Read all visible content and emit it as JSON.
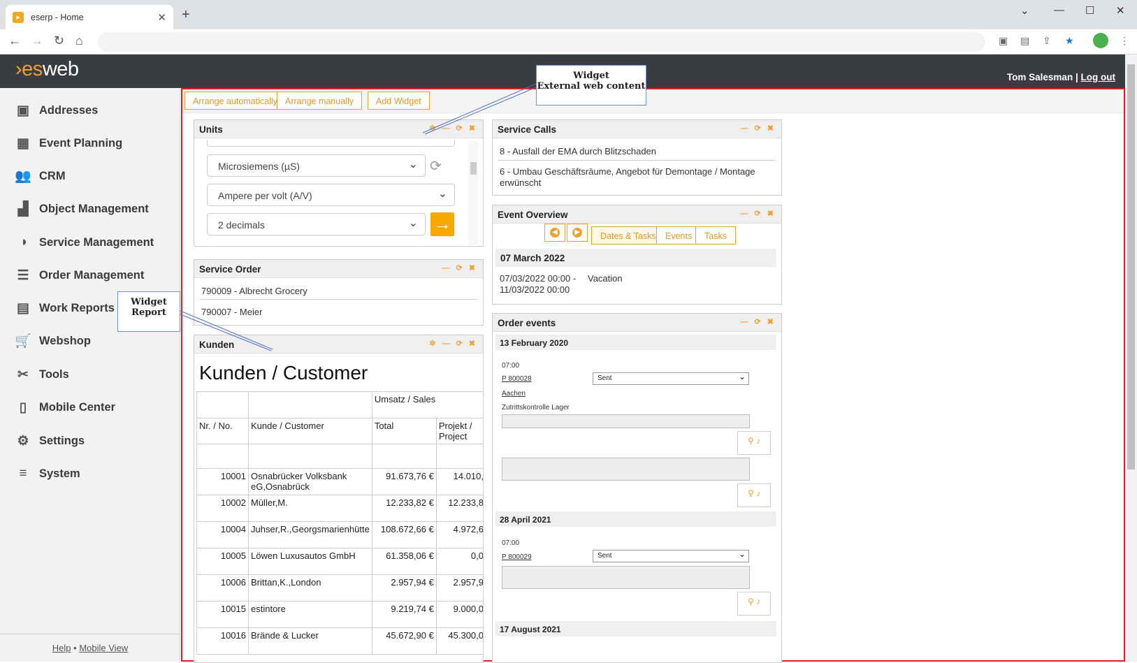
{
  "browser": {
    "tab_title": "eserp - Home",
    "new_tab": "+",
    "close": "✕"
  },
  "app": {
    "logo_accent": "›",
    "logo_es": "es",
    "logo_web": "web",
    "user_name": "Tom Salesman",
    "separator": "|",
    "logout": "Log out"
  },
  "sidebar": {
    "items": [
      {
        "label": "Addresses",
        "icon": "address-book-icon",
        "glyph": "▣"
      },
      {
        "label": "Event Planning",
        "icon": "calendar-icon",
        "glyph": "▦"
      },
      {
        "label": "CRM",
        "icon": "people-icon",
        "glyph": "👥"
      },
      {
        "label": "Object Management",
        "icon": "factory-icon",
        "glyph": "▟"
      },
      {
        "label": "Service Management",
        "icon": "headset-icon",
        "glyph": "◑"
      },
      {
        "label": "Order Management",
        "icon": "list-icon",
        "glyph": "☰"
      },
      {
        "label": "Work Reports",
        "icon": "clipboard-icon",
        "glyph": "▤"
      },
      {
        "label": "Webshop",
        "icon": "cart-icon",
        "glyph": "🛒"
      },
      {
        "label": "Tools",
        "icon": "tools-icon",
        "glyph": "✂"
      },
      {
        "label": "Mobile Center",
        "icon": "mobile-icon",
        "glyph": "▯"
      },
      {
        "label": "Settings",
        "icon": "gear-icon",
        "glyph": "⚙"
      },
      {
        "label": "System",
        "icon": "database-icon",
        "glyph": "≡"
      }
    ],
    "help": "Help",
    "dot": "•",
    "mobile_view": "Mobile View"
  },
  "toolbar": {
    "arrange_auto": "Arrange automatically",
    "arrange_manual": "Arrange manually",
    "add_widget": "Add Widget"
  },
  "units": {
    "title": "Units",
    "select1": "Microsiemens (µS)",
    "select2": "Ampere per volt (A/V)",
    "select3": "2 decimals",
    "go": "→"
  },
  "service_order": {
    "title": "Service Order",
    "rows": [
      "790009 - Albrecht Grocery",
      "790007 - Meier"
    ]
  },
  "kunden": {
    "title": "Kunden",
    "heading": "Kunden / Customer",
    "group_header": "Umsatz / Sales",
    "headers": [
      "Nr. / No.",
      "Kunde / Customer",
      "Total",
      "Projekt / Project"
    ],
    "rows": [
      [
        "10001",
        "Osnabrücker Volksbank eG,Osnabrück",
        "91.673,76 €",
        "14.010,"
      ],
      [
        "10002",
        "Müller,M.",
        "12.233,82 €",
        "12.233,8"
      ],
      [
        "10004",
        "Juhser,R.,Georgsmarienhütte",
        "108.672,66 €",
        "4.972,6"
      ],
      [
        "10005",
        "Löwen Luxusautos GmbH",
        "61.358,06 €",
        "0,0"
      ],
      [
        "10006",
        "Brittan,K.,London",
        "2.957,94 €",
        "2.957,9"
      ],
      [
        "10015",
        "estintore",
        "9.219,74 €",
        "9.000,0"
      ],
      [
        "10016",
        "Brände & Lucker",
        "45.672,90 €",
        "45.300,0"
      ]
    ]
  },
  "service_calls": {
    "title": "Service Calls",
    "rows": [
      "8 - Ausfall der EMA durch Blitzschaden",
      "6 - Umbau Geschäftsräume, Angebot für Demontage / Montage erwünscht"
    ]
  },
  "event_overview": {
    "title": "Event Overview",
    "tabs": [
      "Dates & Tasks",
      "Events",
      "Tasks"
    ],
    "date": "07 March 2022",
    "range_start": "07/03/2022 00:00 -",
    "range_end": "11/03/2022 00:00",
    "event": "Vacation"
  },
  "order_events": {
    "title": "Order events",
    "day1": "13 February 2020",
    "time1": "07:00",
    "order1": "P 800028",
    "city1": "Aachen",
    "desc1": "Zutrittskontrolle Lager",
    "status1": "Sent",
    "day2": "28 April 2021",
    "time2": "07:00",
    "order2": "P 800029",
    "status2": "Sent",
    "day3": "17 August 2021"
  },
  "callouts": {
    "ext_line1": "Widget",
    "ext_line2": "External web content",
    "rep_line1": "Widget",
    "rep_line2": "Report"
  },
  "colors": {
    "accent": "#f0a030",
    "header_bg": "#393d3f",
    "highlight_border": "#e02020"
  }
}
